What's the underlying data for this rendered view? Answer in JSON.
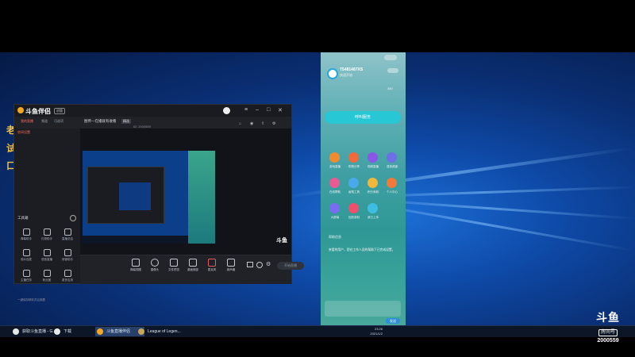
{
  "app": {
    "brand": "斗鱼伴侣",
    "version_badge": "初版",
    "title": "图传—在播就有收看",
    "badge": "精选",
    "left_tabs": [
      "我的直播",
      "频道",
      "可选项"
    ],
    "room_label": "房间设置",
    "room_status": "开始直播",
    "toolbar_title": "工具箱",
    "tools": [
      "弹幕助手",
      "礼物助手",
      "直播总结",
      "观众连麦",
      "语音直播",
      "房管助手",
      "主播任务",
      "粉丝团",
      "更多应用"
    ],
    "toolbar_items": [
      "弹幕视图",
      "摄像头",
      "文件预览",
      "桌面捕捉",
      "麦克风",
      "扬声器"
    ],
    "start_live_label": "开始直播",
    "footer_note": "一键保存精彩并且观看",
    "info_line": "ID: 2000559"
  },
  "side_panel": {
    "user_name": "T5481487XS",
    "user_sub": "快速开始",
    "call_button": "呼叫服务",
    "stat_label": "380",
    "apps": [
      {
        "label": "游戏直播",
        "color": "#f28a2e"
      },
      {
        "label": "购物分享",
        "color": "#f06a3a"
      },
      {
        "label": "视频直播",
        "color": "#8a57e8"
      },
      {
        "label": "语音频道",
        "color": "#6e6fe8"
      },
      {
        "label": "在线帮助",
        "color": "#e85a90"
      },
      {
        "label": "画笔工具",
        "color": "#4aa9ea"
      },
      {
        "label": "积分商城",
        "color": "#f2b63a"
      },
      {
        "label": "个人中心",
        "color": "#ef7a3a"
      },
      {
        "label": "大屏幕",
        "color": "#7a6cf0"
      },
      {
        "label": "回放录制",
        "color": "#f0506a"
      },
      {
        "label": "我已上传",
        "color": "#3dbde2"
      }
    ],
    "notice_title": "帮助信息",
    "notice_text": "亲爱的用户，您在工作人员的帮助下已完成设置。",
    "send_label": "发送"
  },
  "taskbar": {
    "items": [
      {
        "label": "获取斗鱼直播 - G..."
      },
      {
        "label": "下载"
      },
      {
        "label": "斗鱼直播伴侣"
      },
      {
        "label": "League of Legen..."
      }
    ],
    "time": "23:26",
    "date": "2021/1/2"
  },
  "left_edge_chars": [
    "老",
    "试",
    "口"
  ],
  "watermark": {
    "brand": "斗鱼",
    "sub": "房间号",
    "room_id": "2000559"
  },
  "colors": {
    "accent": "#ff6a5c",
    "desktop": "#0e4aa8",
    "panel": "#3f9fa3"
  }
}
